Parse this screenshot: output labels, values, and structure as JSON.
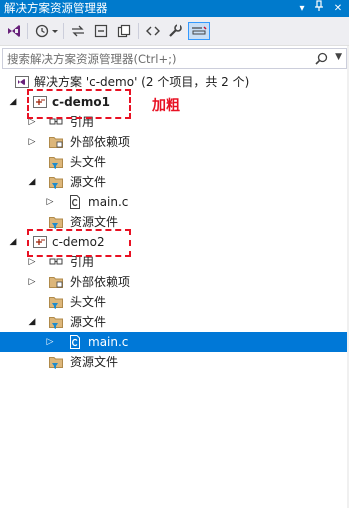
{
  "titlebar": {
    "title": "解决方案资源管理器",
    "btn_dropdown": "▾",
    "btn_pin": "⊕",
    "btn_close": "✕"
  },
  "toolbar": {
    "tools": [
      "vs-icon",
      "history-icon",
      "sync-icon",
      "collapse-icon",
      "pages-icon",
      "code-icon",
      "wrench-icon",
      "preview-icon"
    ]
  },
  "search": {
    "placeholder": "搜索解决方案资源管理器(Ctrl+;)"
  },
  "tree": {
    "solution_label": "解决方案 'c-demo' (2 个项目，共 2 个)",
    "project1": {
      "name": "c-demo1",
      "ref": "引用",
      "ext_deps": "外部依赖项",
      "headers": "头文件",
      "sources": "源文件",
      "main": "main.c",
      "resources": "资源文件"
    },
    "project2": {
      "name": "c-demo2",
      "ref": "引用",
      "ext_deps": "外部依赖项",
      "headers": "头文件",
      "sources": "源文件",
      "main": "main.c",
      "resources": "资源文件"
    }
  },
  "annotation": {
    "text": "加粗",
    "color": "#e81123"
  },
  "colors": {
    "accent": "#007acc",
    "selection": "#0078d7"
  }
}
